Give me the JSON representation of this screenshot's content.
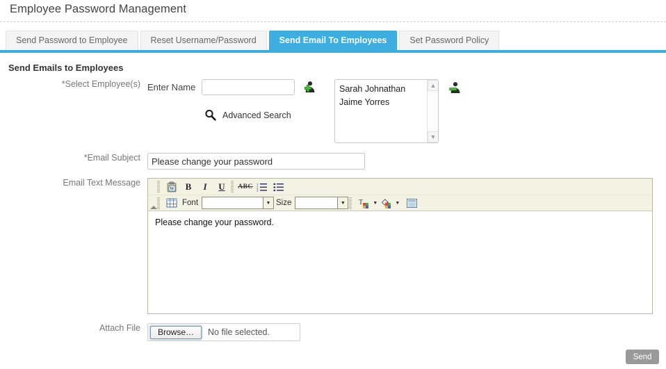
{
  "header": {
    "title": "Employee Password Management"
  },
  "tabs": [
    {
      "label": "Send Password to Employee",
      "active": false
    },
    {
      "label": "Reset Username/Password",
      "active": false
    },
    {
      "label": "Send Email To Employees",
      "active": true
    },
    {
      "label": "Set Password Policy",
      "active": false
    }
  ],
  "section": {
    "title": "Send Emails to Employees"
  },
  "form": {
    "select_employees": {
      "label": "*Select Employee(s)",
      "enter_name_label": "Enter Name",
      "name_input_value": "",
      "name_input_placeholder": "",
      "add_icon": "add-person-icon",
      "remove_icon": "remove-person-icon",
      "advanced_search_label": "Advanced Search",
      "advanced_search_icon": "search-icon",
      "selected_employees": [
        "Sarah Johnathan",
        "Jaime Yorres"
      ],
      "scroll_up_icon": "chevron-up-icon",
      "scroll_down_icon": "chevron-down-icon"
    },
    "email_subject": {
      "label": "*Email Subject",
      "value": "Please change your password",
      "placeholder": ""
    },
    "email_text": {
      "label": "Email Text Message",
      "body": "Please change your password.",
      "toolbar": {
        "row1": [
          {
            "name": "paste-from-word-icon",
            "label": ""
          },
          {
            "name": "bold-icon",
            "label": "B"
          },
          {
            "name": "italic-icon",
            "label": "I"
          },
          {
            "name": "underline-icon",
            "label": "U"
          },
          {
            "name": "strikethrough-icon",
            "label": "ABC"
          },
          {
            "name": "numbered-list-icon",
            "label": ""
          },
          {
            "name": "bullet-list-icon",
            "label": ""
          }
        ],
        "row2": {
          "table_icon": "insert-table-icon",
          "font_label": "Font",
          "font_value": "",
          "size_label": "Size",
          "size_value": "",
          "text_color_icon": "text-color-icon",
          "background_color_icon": "background-color-icon",
          "panel_icon": "panel-icon"
        }
      }
    },
    "attach_file": {
      "label": "Attach File",
      "browse_label": "Browse…",
      "file_status": "No file selected."
    }
  },
  "actions": {
    "send_label": "Send"
  },
  "colors": {
    "accent": "#3eaee0",
    "toolbar_bg": "#f3f3e4",
    "send_button": "#9a9a9a",
    "label_text": "#777777"
  }
}
